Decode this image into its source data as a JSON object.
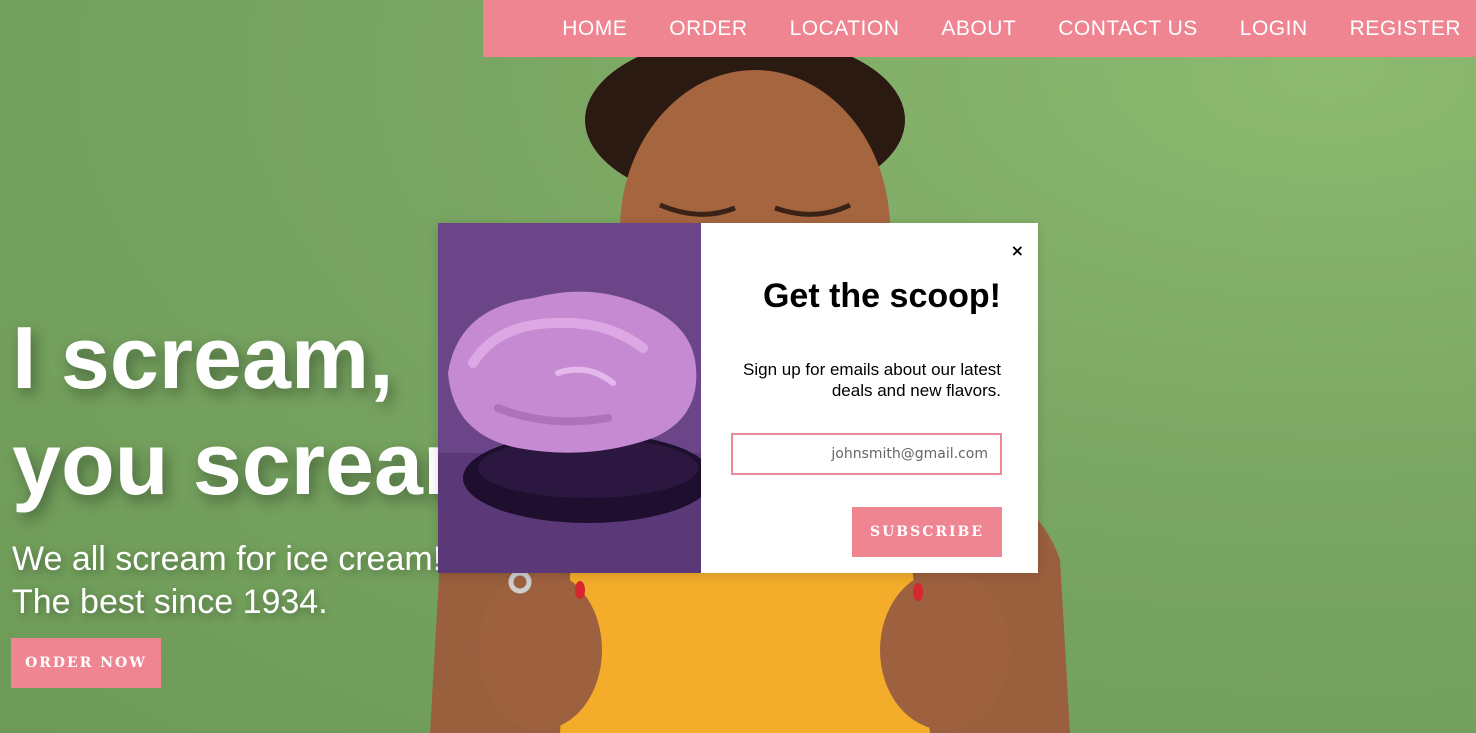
{
  "colors": {
    "accent": "#ee8591",
    "background": "#7aa563",
    "shirt": "#f3ad2a",
    "popup_image_bg": "#6a4588"
  },
  "nav": {
    "items": [
      {
        "label": "HOME"
      },
      {
        "label": "ORDER"
      },
      {
        "label": "LOCATION"
      },
      {
        "label": "ABOUT"
      },
      {
        "label": "CONTACT US"
      },
      {
        "label": "LOGIN"
      },
      {
        "label": "REGISTER"
      }
    ]
  },
  "hero": {
    "title_line1": "I scream,",
    "title_line2": "you scream,",
    "subtitle_line1": "We all scream for ice cream!",
    "subtitle_line2": "The best since 1934.",
    "cta_label": "ORDER NOW"
  },
  "popup": {
    "close_label": "×",
    "title": "Get the scoop!",
    "text": "Sign up for emails about our latest deals and new flavors.",
    "email_placeholder": "johnsmith@gmail.com",
    "subscribe_label": "SUBSCRIBE",
    "image_icon": "ice-cream-scoop-image"
  }
}
